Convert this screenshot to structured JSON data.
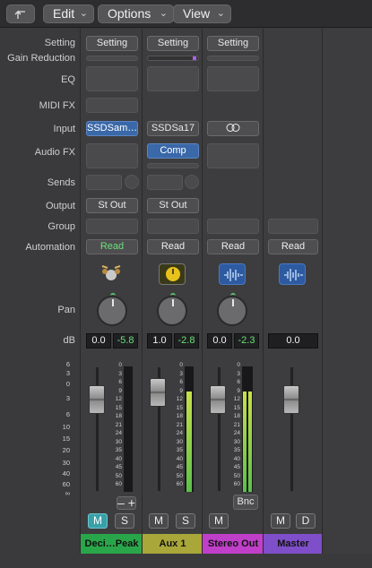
{
  "toolbar": {
    "edit": "Edit",
    "options": "Options",
    "view": "View"
  },
  "labels": {
    "setting": "Setting",
    "gain": "Gain Reduction",
    "eq": "EQ",
    "midifx": "MIDI FX",
    "input": "Input",
    "audiofx": "Audio FX",
    "sends": "Sends",
    "output": "Output",
    "group": "Group",
    "automation": "Automation",
    "pan": "Pan",
    "db": "dB"
  },
  "scale": [
    "6",
    "3",
    "0",
    "3",
    "6",
    "10",
    "15",
    "20",
    "30",
    "40",
    "60",
    "∞"
  ],
  "meter_scale": [
    "0",
    "3",
    "6",
    "9",
    "12",
    "15",
    "18",
    "21",
    "24",
    "30",
    "35",
    "40",
    "45",
    "50",
    "60"
  ],
  "strips": [
    {
      "setting": "Setting",
      "input": "SSDSam…",
      "output": "St Out",
      "automation": "Read",
      "vol": "0.0",
      "peak": "-5.8",
      "mute": "M",
      "solo": "S",
      "name": "Deci…Peak",
      "name_color": "#2aa64a",
      "icon": "drum-kit-icon"
    },
    {
      "setting": "Setting",
      "input": "SSDSa17",
      "audiofx": "Comp",
      "output": "St Out",
      "automation": "Read",
      "vol": "1.0",
      "peak": "-2.8",
      "mute": "M",
      "solo": "S",
      "name": "Aux 1",
      "name_color": "#a9a63a",
      "icon": "clock-icon"
    },
    {
      "setting": "Setting",
      "input": "∞",
      "automation": "Read",
      "vol": "0.0",
      "peak": "-2.3",
      "mute": "M",
      "bnc": "Bnc",
      "name": "Stereo Out",
      "name_color": "#c03fc9",
      "icon": "waveform-icon"
    },
    {
      "automation": "Read",
      "vol": "0.0",
      "mute": "M",
      "dim": "D",
      "name": "Master",
      "name_color": "#7e4fc9",
      "icon": "waveform-icon"
    }
  ],
  "add_button": "+",
  "minus_button": "–"
}
